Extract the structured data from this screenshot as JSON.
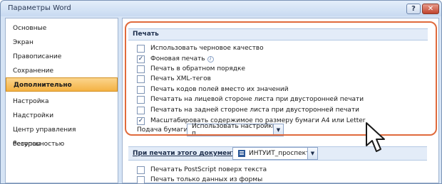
{
  "window": {
    "title": "Параметры Word",
    "help_label": "?",
    "close_label": "✕"
  },
  "sidebar": {
    "items": [
      {
        "label": "Основные"
      },
      {
        "label": "Экран"
      },
      {
        "label": "Правописание"
      },
      {
        "label": "Сохранение"
      },
      {
        "label": "Дополнительно",
        "active": true
      },
      {
        "label": "Настройка"
      },
      {
        "label": "Надстройки"
      },
      {
        "label": "Центр управления безопасностью"
      },
      {
        "label": "Ресурсы"
      }
    ]
  },
  "print_section": {
    "header": "Печать",
    "options": [
      {
        "label": "Использовать черновое качество",
        "checked": false
      },
      {
        "label": "Фоновая печать",
        "checked": true,
        "info_icon": "info-icon"
      },
      {
        "label": "Печать в обратном порядке",
        "checked": false
      },
      {
        "label": "Печать XML-тегов",
        "checked": false
      },
      {
        "label": "Печать кодов полей вместо их значений",
        "checked": false
      },
      {
        "label": "Печатать на лицевой стороне листа при двусторонней печати",
        "checked": false
      },
      {
        "label": "Печатать на задней стороне листа при двусторонней печати",
        "checked": false
      },
      {
        "label": "Масштабировать содержимое по размеру бумаги A4 или Letter",
        "checked": true
      }
    ],
    "paper_feed_label": "Подача бумаги:",
    "paper_feed_value": "Использовать настройки п..."
  },
  "doc_print_section": {
    "label": "При печати этого документа:",
    "document_value": "ИНТУИТ_проспект",
    "options": [
      {
        "label": "Печатать PostScript поверх текста",
        "checked": false
      },
      {
        "label": "Печать только данных из формы",
        "checked": false
      }
    ]
  },
  "colors": {
    "accent": "#e06a3c",
    "active_item": "#f4b244",
    "section_bg": "#e3ecf8"
  },
  "icons": {
    "check": "✓",
    "dropdown": "▼",
    "info": "i",
    "cursor": "mouse-pointer-icon"
  }
}
